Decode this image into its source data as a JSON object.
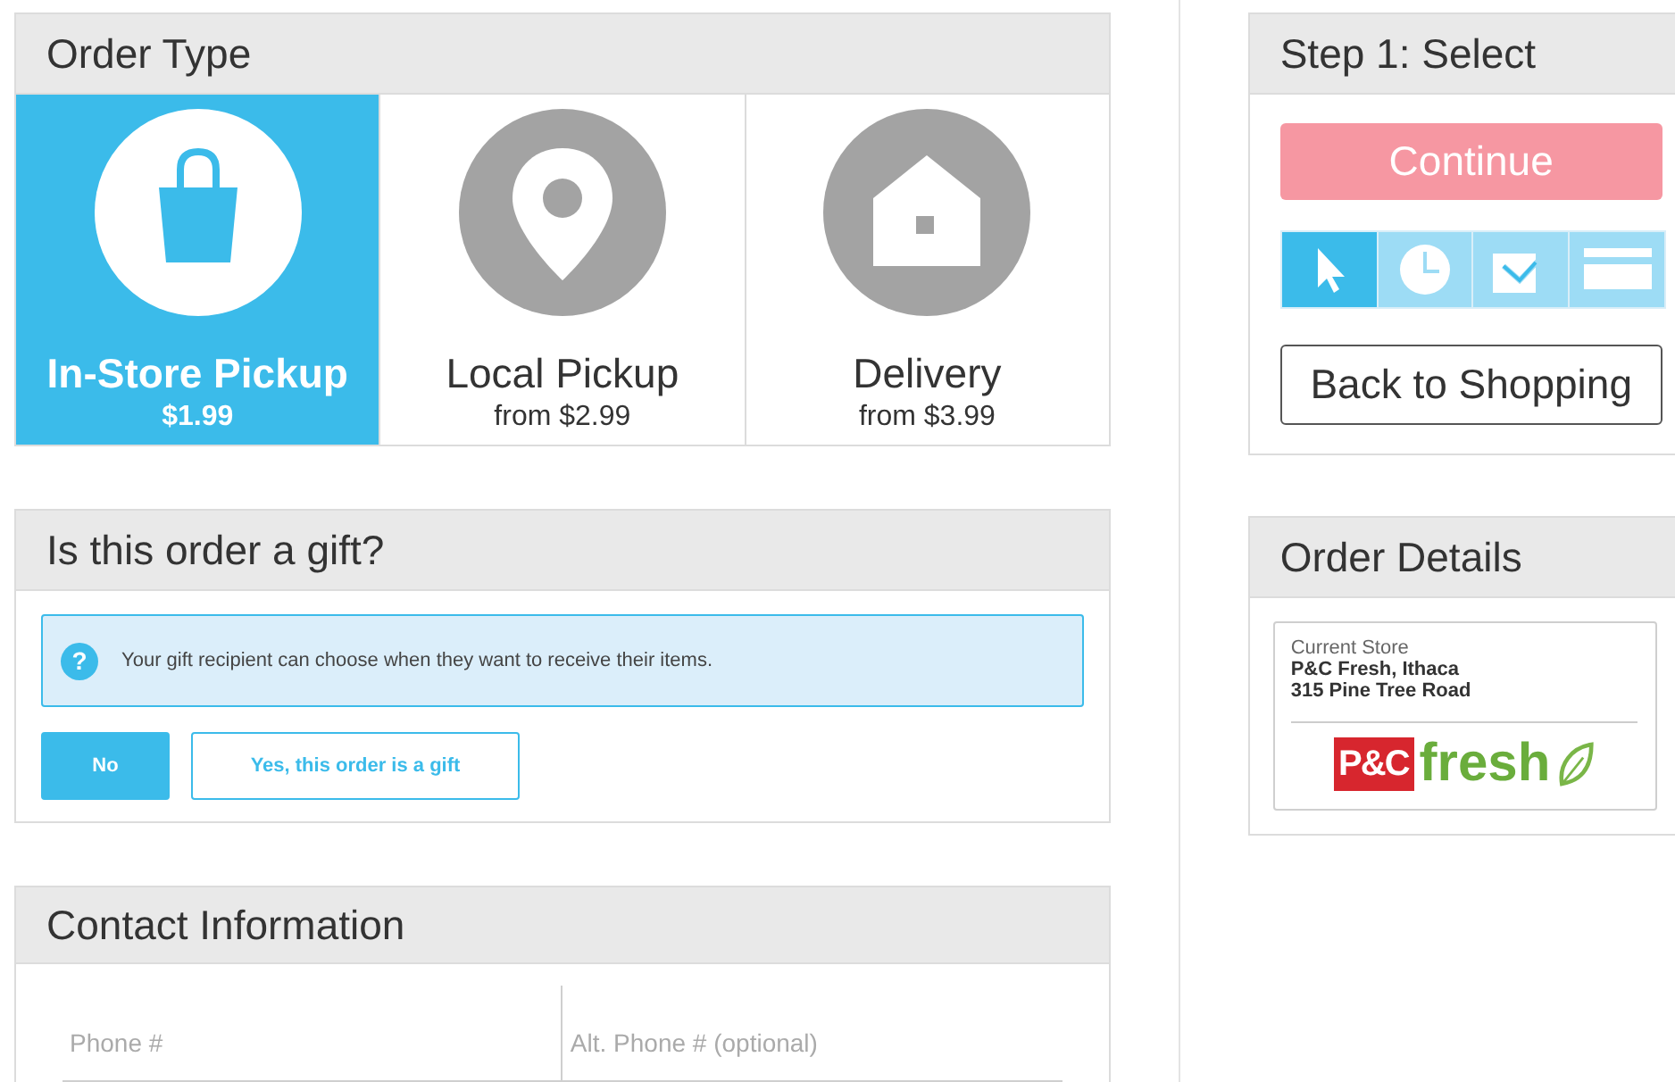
{
  "order_type": {
    "title": "Order Type",
    "options": [
      {
        "kind": "bag",
        "label": "In-Store Pickup",
        "price": "$1.99",
        "selected": true
      },
      {
        "kind": "pin",
        "label": "Local Pickup",
        "price": "from $2.99",
        "selected": false
      },
      {
        "kind": "house",
        "label": "Delivery",
        "price": "from $3.99",
        "selected": false
      }
    ]
  },
  "gift": {
    "title": "Is this order a gift?",
    "info_icon": "?",
    "info": "Your gift recipient can choose when they want to receive their items.",
    "buttons": [
      {
        "label": "No",
        "selected": true
      },
      {
        "label": "Yes, this order is a gift",
        "selected": false
      }
    ]
  },
  "contact": {
    "title": "Contact Information",
    "fields": [
      {
        "placeholder": "Phone #"
      },
      {
        "placeholder": "Alt. Phone # (optional)"
      }
    ]
  },
  "step": {
    "title": "Step 1: Select",
    "continue": "Continue",
    "steps": [
      {
        "kind": "pointer",
        "selected": true
      },
      {
        "kind": "clock",
        "selected": false
      },
      {
        "kind": "check",
        "selected": false
      },
      {
        "kind": "card",
        "selected": false
      }
    ],
    "back": "Back to Shopping"
  },
  "order_details": {
    "title": "Order Details",
    "store_label": "Current Store",
    "store_name": "P&C Fresh, Ithaca",
    "store_address": "315 Pine Tree Road",
    "logo": {
      "mark": "P&C",
      "word": "fresh"
    }
  }
}
